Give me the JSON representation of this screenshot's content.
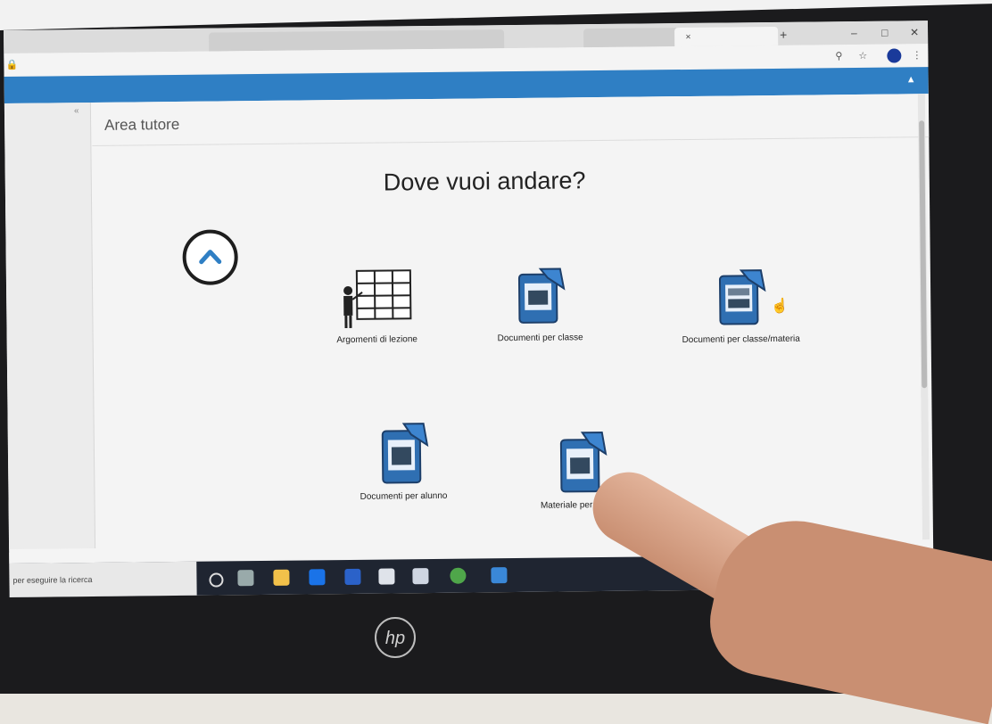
{
  "browser": {
    "tabs": [
      {
        "label": "",
        "active": false
      },
      {
        "label": "",
        "active": false
      },
      {
        "label": "",
        "active": false
      },
      {
        "label": "",
        "active": false
      },
      {
        "label": "",
        "active": false
      },
      {
        "label": "",
        "active": true
      }
    ],
    "new_tab": "+",
    "url": "",
    "window_controls": [
      "–",
      "□",
      "✕"
    ]
  },
  "app": {
    "brand": "",
    "user_info": "",
    "user_icon": "user-icon"
  },
  "sidebar": {
    "collapse": "«",
    "item": "",
    "footer": ""
  },
  "main": {
    "title": "Area tutore",
    "heading": "Dove vuoi andare?",
    "tiles": [
      {
        "label": "Argomenti di lezione",
        "icon": "classroom-icon"
      },
      {
        "label": "Documenti per classe",
        "icon": "class-documents-icon"
      },
      {
        "label": "Documenti per classe/materia",
        "icon": "class-subject-documents-icon"
      },
      {
        "label": "Documenti per alunno",
        "icon": "student-documents-icon"
      },
      {
        "label": "Materiale per docenti",
        "icon": "teacher-materials-icon"
      }
    ]
  },
  "taskbar": {
    "search_placeholder": "per eseguire la ricerca"
  },
  "device": {
    "brand_logo": "hp"
  }
}
